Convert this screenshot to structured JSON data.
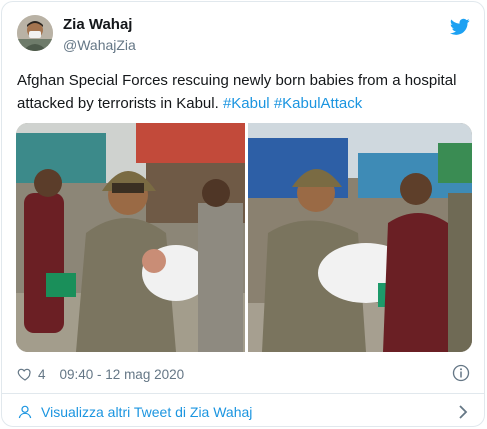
{
  "tweet": {
    "author_name": "Zia Wahaj",
    "author_handle": "@WahajZia",
    "text_plain": "Afghan Special Forces rescuing newly born babies from a hospital  attacked by terrorists in Kabul.",
    "hashtags": [
      "#Kabul",
      "#KabulAttack"
    ],
    "likes": "4",
    "timestamp": "09:40 - 12 mag 2020",
    "more_link": "Visualizza altri Tweet di Zia Wahaj"
  },
  "icons": {
    "brand": "twitter-bird-icon",
    "like": "heart-icon",
    "info": "info-icon",
    "user": "user-icon",
    "chevron": "chevron-right-icon"
  },
  "colors": {
    "brand_blue": "#1da1f2",
    "link_blue": "#1b95e0",
    "text": "#14171a",
    "secondary": "#657786",
    "border": "#e1e8ed"
  }
}
